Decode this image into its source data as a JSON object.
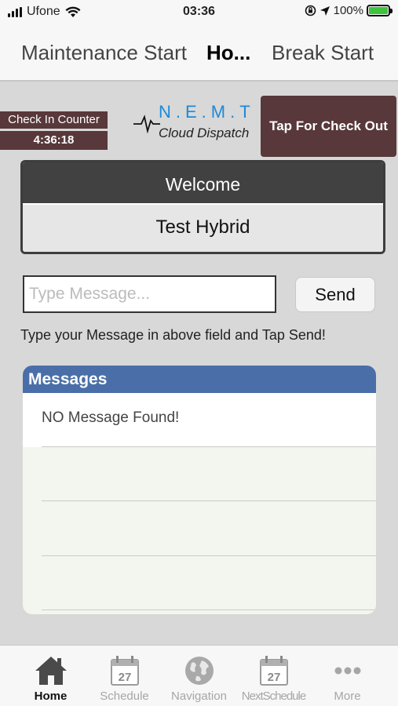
{
  "status_bar": {
    "carrier": "Ufone",
    "time": "03:36",
    "battery": "100%"
  },
  "top_nav": [
    {
      "label": "Maintenance Start",
      "active": false
    },
    {
      "label": "Ho...",
      "active": true
    },
    {
      "label": "Break Start",
      "active": false
    }
  ],
  "counter": {
    "label": "Check In Counter",
    "value": "4:36:18"
  },
  "logo": {
    "line1": "N.E.M.T",
    "line2": "Cloud Dispatch"
  },
  "checkout_button": "Tap For Check Out",
  "welcome": {
    "title": "Welcome",
    "name": "Test Hybrid"
  },
  "message_input": {
    "placeholder": "Type Message...",
    "value": ""
  },
  "send_button": "Send",
  "hint": "Type your Message in above field and Tap Send!",
  "messages": {
    "title": "Messages",
    "empty_text": "NO Message Found!"
  },
  "tab_bar": [
    {
      "label": "Home",
      "icon": "home-icon",
      "active": true
    },
    {
      "label": "Schedule",
      "icon": "calendar-icon",
      "calendar_day": "27",
      "active": false
    },
    {
      "label": "Navigation",
      "icon": "globe-icon",
      "active": false
    },
    {
      "label": "NextSchedule",
      "icon": "calendar-icon",
      "calendar_day": "27",
      "active": false
    },
    {
      "label": "More",
      "icon": "more-icon",
      "active": false
    }
  ],
  "colors": {
    "accent_dark": "#58383a",
    "messages_header": "#4a6fa8",
    "logo_blue": "#1d8ad8",
    "battery_fill": "#3cc43c"
  }
}
